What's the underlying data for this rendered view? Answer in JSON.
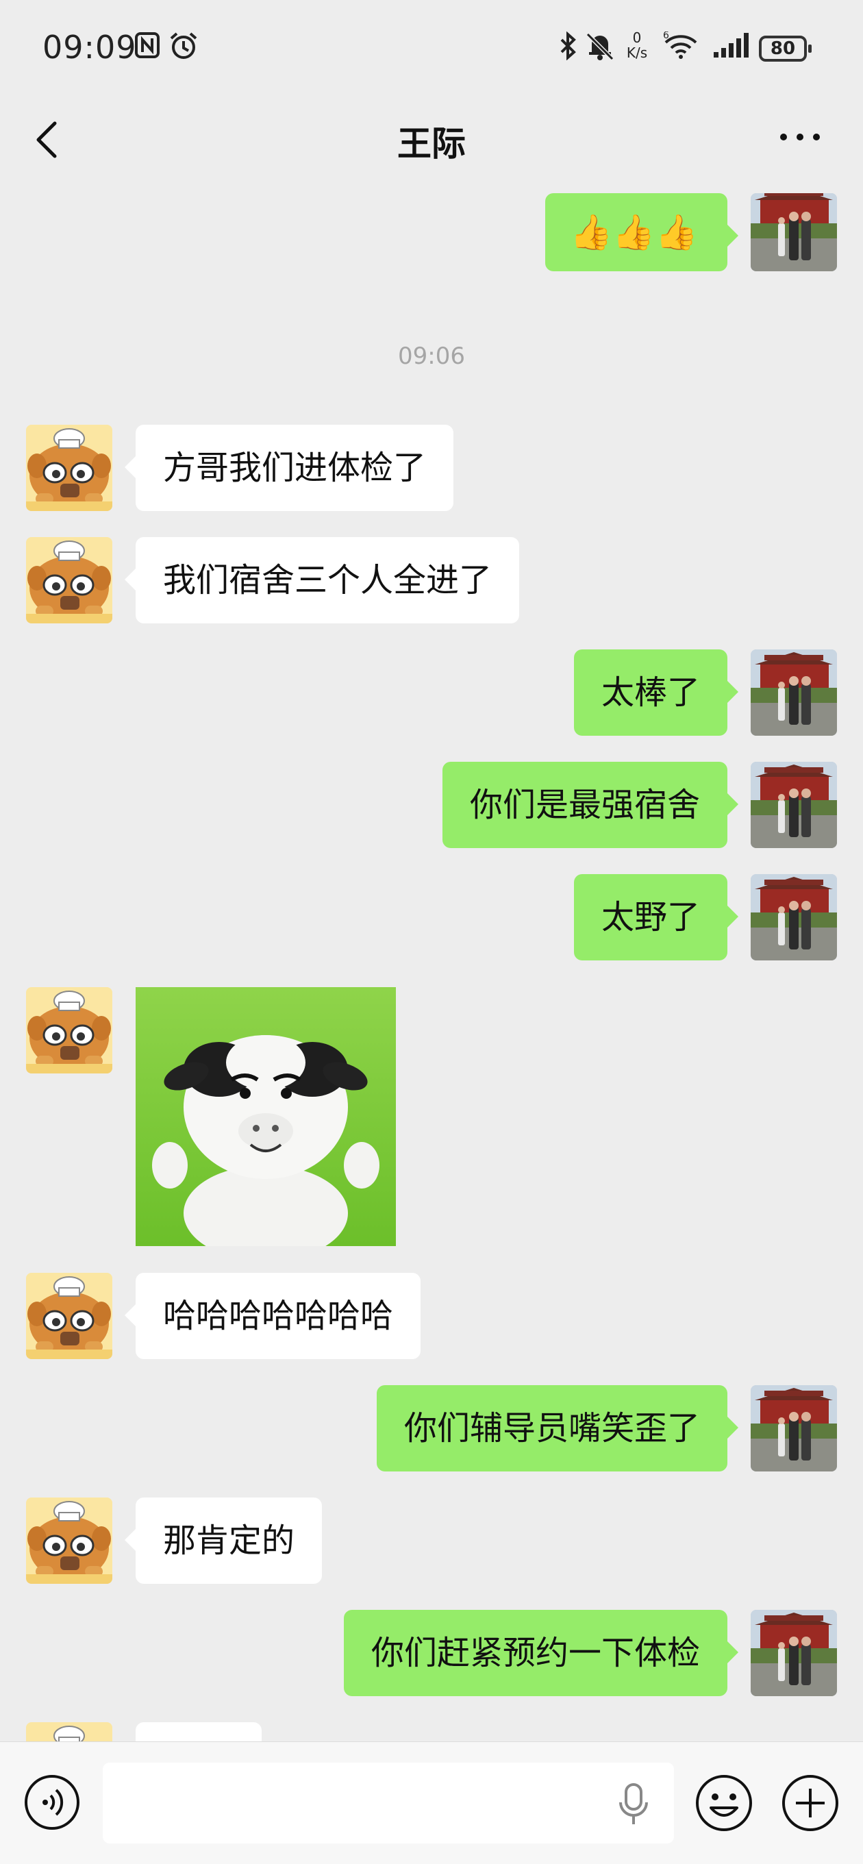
{
  "status_bar": {
    "time": "09:09",
    "net_rate_value": "0",
    "net_rate_unit": "K/s",
    "battery": "80",
    "icons": [
      "nfc-icon",
      "alarm-icon",
      "bluetooth-icon",
      "mute-bell-icon",
      "wifi-icon",
      "signal-icon",
      "battery-icon"
    ]
  },
  "header": {
    "title": "王际",
    "back_icon": "chevron-left-icon",
    "more_icon": "more-dots-icon"
  },
  "chat": {
    "sent_top_emoji": "👍👍👍",
    "timestamp": "09:06",
    "messages": [
      {
        "from": "them",
        "text": "方哥我们进体检了"
      },
      {
        "from": "them",
        "text": "我们宿舍三个人全进了"
      },
      {
        "from": "me",
        "text": "太棒了"
      },
      {
        "from": "me",
        "text": "你们是最强宿舍"
      },
      {
        "from": "me",
        "text": "太野了"
      },
      {
        "from": "them",
        "type": "sticker",
        "sticker": "cow-sticker"
      },
      {
        "from": "them",
        "text": "哈哈哈哈哈哈哈"
      },
      {
        "from": "me",
        "text": "你们辅导员嘴笑歪了"
      },
      {
        "from": "them",
        "text": "那肯定的"
      },
      {
        "from": "me",
        "text": "你们赶紧预约一下体检"
      }
    ]
  },
  "input_bar": {
    "text_value": "",
    "icons": [
      "voice-icon",
      "mic-icon",
      "emoji-icon",
      "plus-icon"
    ]
  },
  "colors": {
    "background": "#ededed",
    "bubble_out": "#95ec69",
    "bubble_in": "#ffffff",
    "timestamp": "#a5a5a5"
  }
}
